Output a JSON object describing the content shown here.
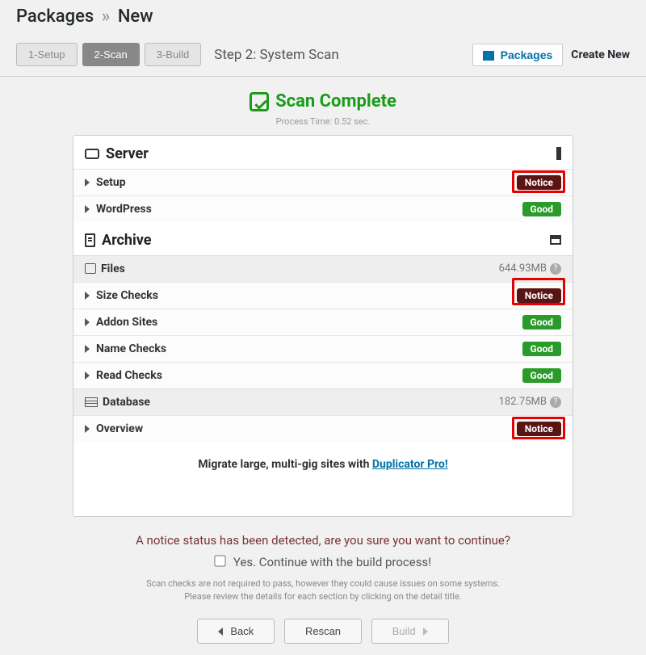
{
  "breadcrumb": {
    "root": "Packages",
    "current": "New"
  },
  "steps": {
    "s1": "1-Setup",
    "s2": "2-Scan",
    "s3": "3-Build",
    "label": "Step 2: System Scan"
  },
  "toolbar_right": {
    "packages": "Packages",
    "create_new": "Create New"
  },
  "scan": {
    "title": "Scan Complete",
    "process_time": "Process Time: 0.52 sec."
  },
  "sections": {
    "server": "Server",
    "archive": "Archive",
    "files": "Files",
    "files_size": "644.93MB",
    "database": "Database",
    "database_size": "182.75MB"
  },
  "rows": {
    "setup": {
      "label": "Setup",
      "status": "Notice"
    },
    "wordpress": {
      "label": "WordPress",
      "status": "Good"
    },
    "size_checks": {
      "label": "Size Checks",
      "status": "Notice"
    },
    "addon_sites": {
      "label": "Addon Sites",
      "status": "Good"
    },
    "name_checks": {
      "label": "Name Checks",
      "status": "Good"
    },
    "read_checks": {
      "label": "Read Checks",
      "status": "Good"
    },
    "overview": {
      "label": "Overview",
      "status": "Notice"
    }
  },
  "promo": {
    "text": "Migrate large, multi-gig sites with ",
    "link": "Duplicator Pro!"
  },
  "notice_msg": "A notice status has been detected, are you sure you want to continue?",
  "confirm_label": "Yes. Continue with the build process!",
  "fineprint": {
    "line1": "Scan checks are not required to pass, however they could cause issues on some systems.",
    "line2": "Please review the details for each section by clicking on the detail title."
  },
  "buttons": {
    "back": "Back",
    "rescan": "Rescan",
    "build": "Build"
  },
  "q": "?"
}
